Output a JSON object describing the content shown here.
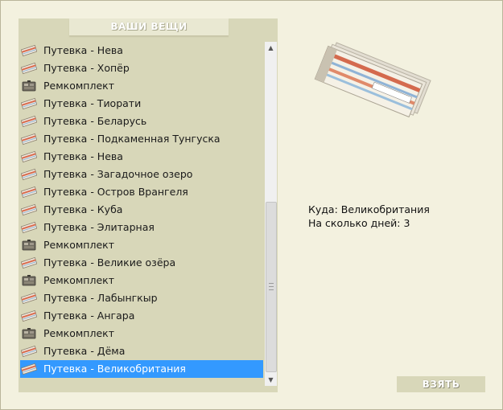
{
  "panel": {
    "title": "ВАШИ ВЕЩИ"
  },
  "items": [
    {
      "label": "Путевка - Нева",
      "icon": "ticket-icon"
    },
    {
      "label": "Путевка - Хопёр",
      "icon": "ticket-icon"
    },
    {
      "label": "Ремкомплект",
      "icon": "repair-kit-icon"
    },
    {
      "label": "Путевка - Тиорати",
      "icon": "ticket-icon"
    },
    {
      "label": "Путевка - Беларусь",
      "icon": "ticket-icon"
    },
    {
      "label": "Путевка - Подкаменная Тунгуска",
      "icon": "ticket-icon"
    },
    {
      "label": "Путевка - Нева",
      "icon": "ticket-icon"
    },
    {
      "label": "Путевка - Загадочное озеро",
      "icon": "ticket-icon"
    },
    {
      "label": "Путевка - Остров Врангеля",
      "icon": "ticket-icon"
    },
    {
      "label": "Путевка - Куба",
      "icon": "ticket-icon"
    },
    {
      "label": "Путевка - Элитарная",
      "icon": "ticket-icon"
    },
    {
      "label": "Ремкомплект",
      "icon": "repair-kit-icon"
    },
    {
      "label": "Путевка - Великие озёра",
      "icon": "ticket-icon"
    },
    {
      "label": "Ремкомплект",
      "icon": "repair-kit-icon"
    },
    {
      "label": "Путевка - Лабынгкыр",
      "icon": "ticket-icon"
    },
    {
      "label": "Путевка - Ангара",
      "icon": "ticket-icon"
    },
    {
      "label": "Ремкомплект",
      "icon": "repair-kit-icon"
    },
    {
      "label": "Путевка - Дёма",
      "icon": "ticket-icon"
    },
    {
      "label": "Путевка - Великобритания",
      "icon": "ticket-icon",
      "selected": true
    }
  ],
  "details": {
    "destination_line": "Куда: Великобритания",
    "days_line": "На сколько дней: 3"
  },
  "take_button": {
    "label": "ВЗЯТЬ"
  },
  "colors": {
    "background": "#f3f1df",
    "panel": "#d8d7b9",
    "selection": "#3399ff"
  }
}
